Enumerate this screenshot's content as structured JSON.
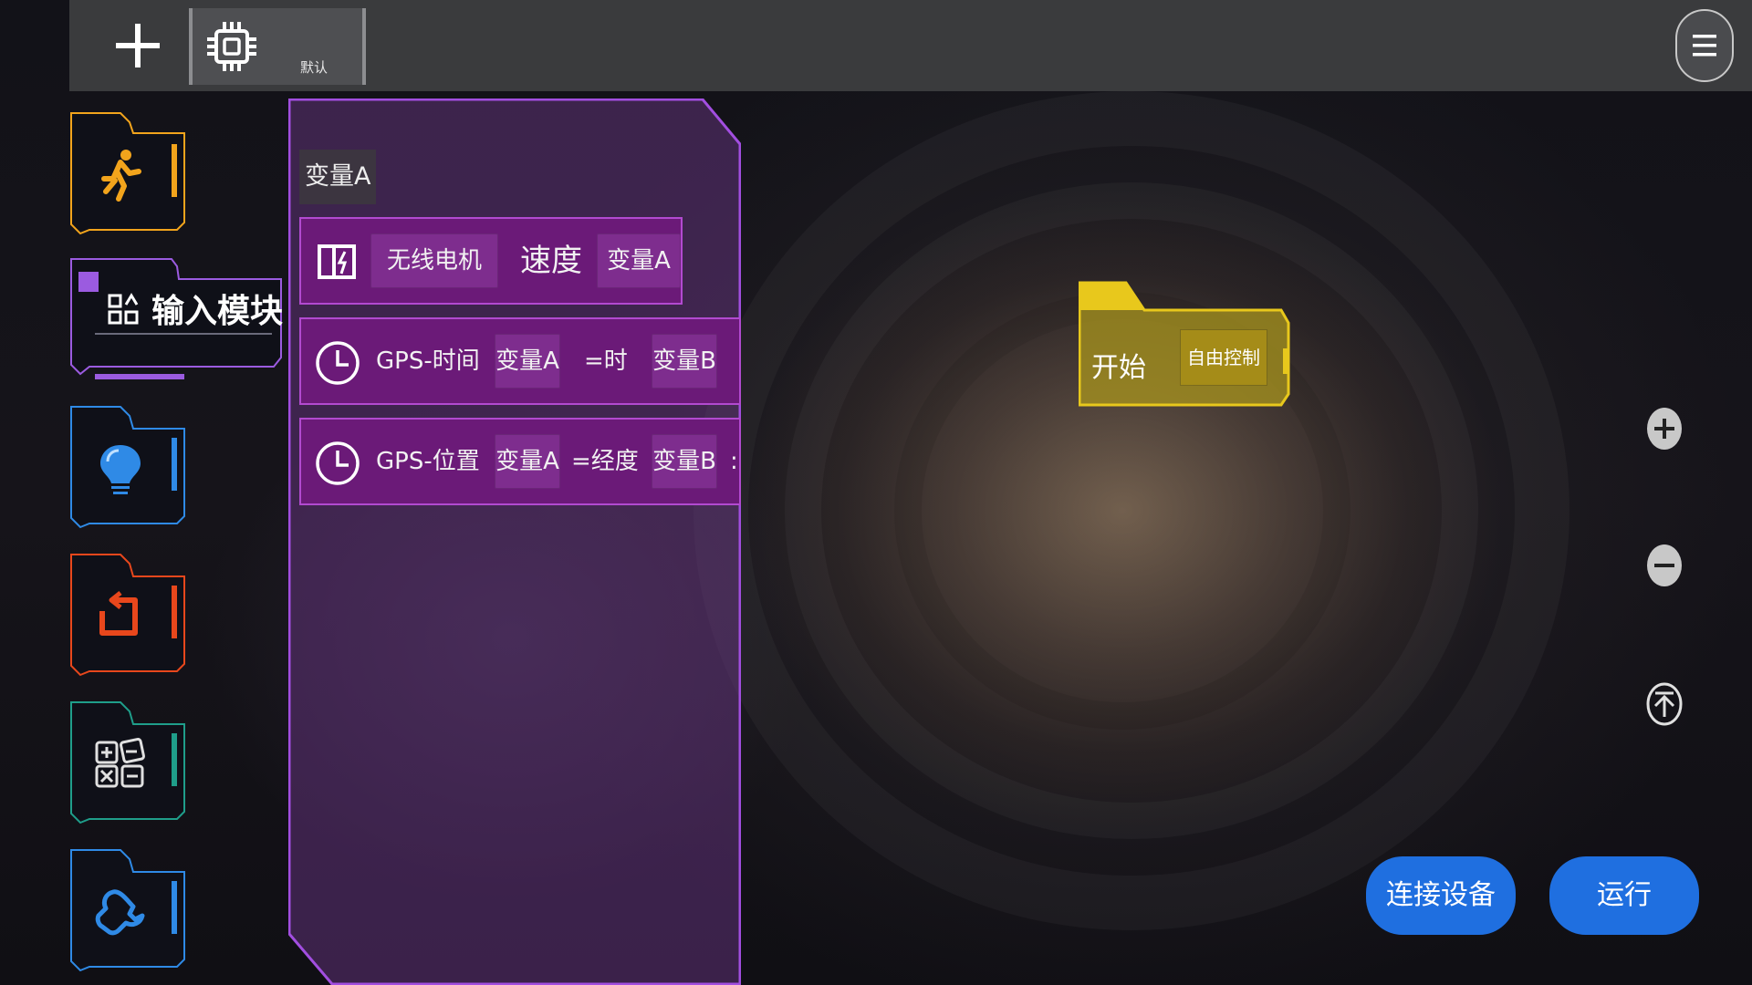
{
  "toolbar": {
    "add_icon": "plus-icon",
    "device_tab": {
      "icon": "chip-icon",
      "label": "默认"
    },
    "menu_icon": "hamburger-menu-icon"
  },
  "categories": [
    {
      "name": "motion",
      "icon": "running-person-icon",
      "color": "#f2a41c"
    },
    {
      "name": "input",
      "icon": "input-module-icon",
      "label": "输入模块",
      "color": "#9b5be0",
      "selected": true
    },
    {
      "name": "light",
      "icon": "bulb-icon",
      "color": "#2f8ae6"
    },
    {
      "name": "control",
      "icon": "loop-icon",
      "color": "#e8471c"
    },
    {
      "name": "math",
      "icon": "calculator-icon",
      "color": "#1f9e8a"
    },
    {
      "name": "tools",
      "icon": "wrench-icon",
      "color": "#2f8ae6"
    }
  ],
  "flyout": {
    "variable_chip": "变量A",
    "blocks": [
      {
        "icon": "motor-icon",
        "parts": [
          "无线电机",
          "速度",
          "变量A"
        ]
      },
      {
        "icon": "clock-icon",
        "parts": [
          "GPS-时间",
          "变量A",
          "=时",
          "变量B"
        ]
      },
      {
        "icon": "clock-icon",
        "parts": [
          "GPS-位置",
          "变量A",
          "=经度",
          "变量B",
          ":"
        ]
      }
    ]
  },
  "workspace": {
    "start_block": {
      "label": "开始",
      "mode": "自由控制",
      "color": "#e8c81c"
    }
  },
  "zoom": {
    "in_icon": "zoom-in-icon",
    "out_icon": "zoom-out-icon",
    "reset_icon": "scroll-top-icon"
  },
  "actions": {
    "connect": "连接设备",
    "run": "运行"
  },
  "colors": {
    "accent": "#1f6fe0",
    "block_purple": "#6b1a78",
    "start_yellow": "#e8c81c"
  }
}
